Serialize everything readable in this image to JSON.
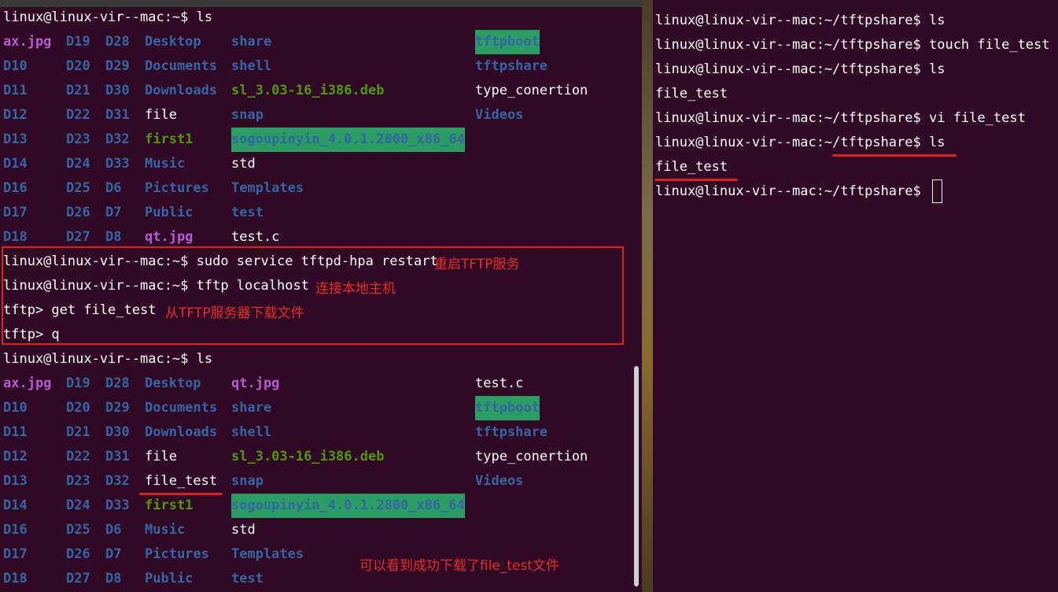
{
  "left": {
    "prompt_ls": "linux@linux-vir--mac:~$ ls",
    "listing1": [
      [
        "ax.jpg",
        "D19",
        "D28",
        "Desktop",
        "share",
        "tftpboot"
      ],
      [
        "D10",
        "D20",
        "D29",
        "Documents",
        "shell",
        "tftpshare"
      ],
      [
        "D11",
        "D21",
        "D30",
        "Downloads",
        "sl_3.03-16_i386.deb",
        "type_conertion"
      ],
      [
        "D12",
        "D22",
        "D31",
        "file",
        "snap",
        "Videos"
      ],
      [
        "D13",
        "D23",
        "D32",
        "first1",
        "sogoupinyin_4.0.1.2800_x86_64",
        ""
      ],
      [
        "D14",
        "D24",
        "D33",
        "Music",
        "std",
        ""
      ],
      [
        "D16",
        "D25",
        "D6",
        "Pictures",
        "Templates",
        ""
      ],
      [
        "D17",
        "D26",
        "D7",
        "Public",
        "test",
        ""
      ],
      [
        "D18",
        "D27",
        "D8",
        "qt.jpg",
        "test.c",
        ""
      ]
    ],
    "cmd_restart": "linux@linux-vir--mac:~$ sudo service tftpd-hpa restart",
    "note_restart": "重启TFTP服务",
    "cmd_tftp": "linux@linux-vir--mac:~$ tftp localhost",
    "note_connect": "连接本地主机",
    "cmd_get": "tftp> get file_test",
    "note_get": "从TFTP服务器下载文件",
    "cmd_quit": "tftp> q",
    "prompt_ls2": "linux@linux-vir--mac:~$ ls",
    "listing2": [
      [
        "ax.jpg",
        "D19",
        "D28",
        "Desktop",
        "qt.jpg",
        "test.c"
      ],
      [
        "D10",
        "D20",
        "D29",
        "Documents",
        "share",
        "tftpboot"
      ],
      [
        "D11",
        "D21",
        "D30",
        "Downloads",
        "shell",
        "tftpshare"
      ],
      [
        "D12",
        "D22",
        "D31",
        "file",
        "sl_3.03-16_i386.deb",
        "type_conertion"
      ],
      [
        "D13",
        "D23",
        "D32",
        "file_test",
        "snap",
        "Videos"
      ],
      [
        "D14",
        "D24",
        "D33",
        "first1",
        "sogoupinyin_4.0.1.2800_x86_64",
        ""
      ],
      [
        "D16",
        "D25",
        "D6",
        "Music",
        "std",
        ""
      ],
      [
        "D17",
        "D26",
        "D7",
        "Pictures",
        "Templates",
        ""
      ],
      [
        "D18",
        "D27",
        "D8",
        "Public",
        "test",
        ""
      ]
    ],
    "note_success": "可以看到成功下载了file_test文件"
  },
  "right": {
    "lines": [
      "linux@linux-vir--mac:~/tftpshare$ ls",
      "linux@linux-vir--mac:~/tftpshare$ touch file_test",
      "linux@linux-vir--mac:~/tftpshare$ ls",
      "file_test",
      "linux@linux-vir--mac:~/tftpshare$ vi file_test",
      "linux@linux-vir--mac:~/tftpshare$ ls",
      "file_test",
      "linux@linux-vir--mac:~/tftpshare$ "
    ]
  },
  "colors": {
    "background": "#300a24",
    "dir_blue": "#3465a4",
    "image_magenta": "#b65ad5",
    "exec_green": "#4e9a06",
    "annotation_red": "#e02020",
    "sticky_bg": "#2a9d63"
  }
}
